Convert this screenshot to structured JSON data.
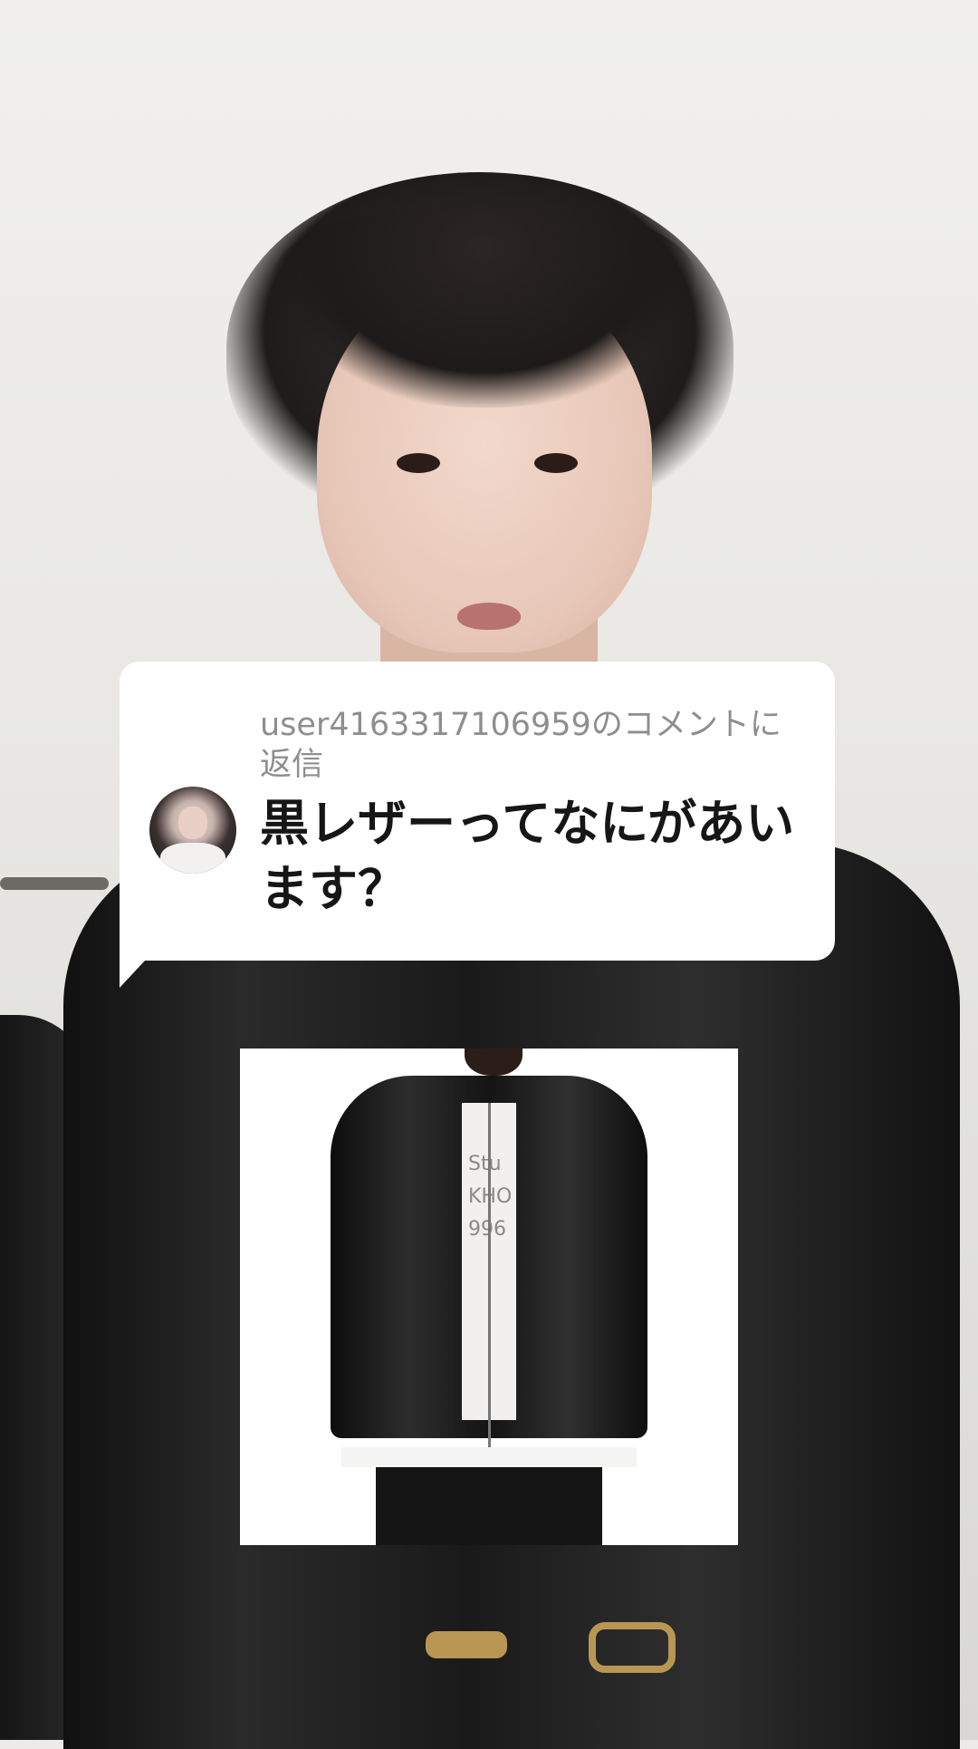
{
  "comment_reply": {
    "header": "user4163317106959のコメントに返信",
    "text": "黒レザーってなにがあいます？"
  },
  "product_image": {
    "tee_print": "Stu\nKHO\n996"
  }
}
